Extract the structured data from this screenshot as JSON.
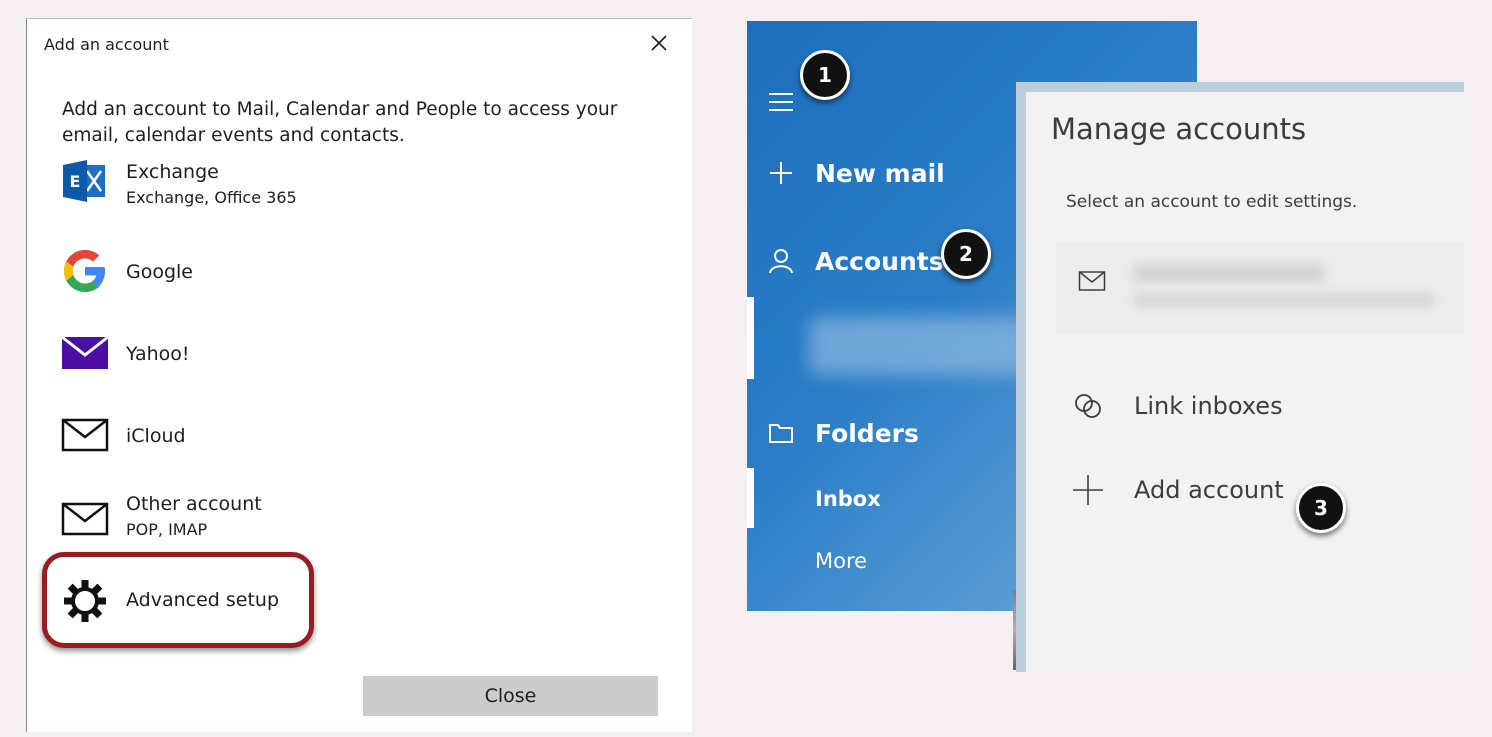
{
  "dialog": {
    "title": "Add an account",
    "intro": "Add an account to Mail, Calendar and People to access your email, calendar events and contacts.",
    "providers": [
      {
        "name": "Exchange",
        "sub": "Exchange, Office 365",
        "icon": "exchange-icon"
      },
      {
        "name": "Google",
        "sub": "",
        "icon": "google-icon"
      },
      {
        "name": "Yahoo!",
        "sub": "",
        "icon": "yahoo-icon"
      },
      {
        "name": "iCloud",
        "sub": "",
        "icon": "mail-icon"
      },
      {
        "name": "Other account",
        "sub": "POP, IMAP",
        "icon": "mail-icon"
      },
      {
        "name": "Advanced setup",
        "sub": "",
        "icon": "gear-icon"
      }
    ],
    "close_label": "Close"
  },
  "nav": {
    "new_mail": "New mail",
    "accounts": "Accounts",
    "folders": "Folders",
    "inbox": "Inbox",
    "more": "More"
  },
  "manage": {
    "title": "Manage accounts",
    "subtitle": "Select an account to edit settings.",
    "link_inboxes": "Link inboxes",
    "add_account": "Add account"
  },
  "callouts": [
    "1",
    "2",
    "3"
  ],
  "colors": {
    "nav_blue": "#1d6fbd",
    "highlight_red": "#9b1c20",
    "close_button": "#cccccc",
    "yahoo_purple": "#4b0fa3",
    "exchange_blue": "#1b6fc4"
  }
}
